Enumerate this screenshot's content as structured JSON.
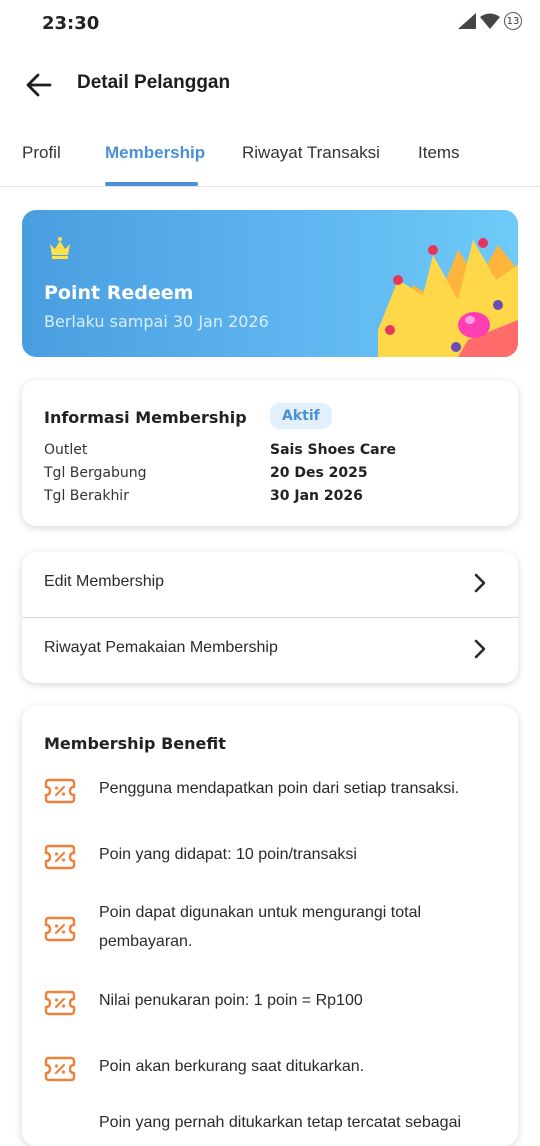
{
  "status_bar": {
    "time": "23:30",
    "notification_count": "13"
  },
  "header": {
    "title": "Detail Pelanggan"
  },
  "tabs": [
    {
      "label": "Profil"
    },
    {
      "label": "Membership"
    },
    {
      "label": "Riwayat Transaksi"
    },
    {
      "label": "Items"
    }
  ],
  "active_tab": "Membership",
  "hero": {
    "title": "Point Redeem",
    "subtitle": "Berlaku sampai 30 Jan 2026"
  },
  "membership_info": {
    "title": "Informasi Membership",
    "status": "Aktif",
    "rows": [
      {
        "label": "Outlet",
        "value": "Sais Shoes Care"
      },
      {
        "label": "Tgl Bergabung",
        "value": "20 Des 2025"
      },
      {
        "label": "Tgl Berakhir",
        "value": "30 Jan 2026"
      }
    ]
  },
  "menu": [
    {
      "label": "Edit Membership"
    },
    {
      "label": "Riwayat Pemakaian Membership"
    }
  ],
  "benefit": {
    "title": "Membership Benefit",
    "items": [
      "Pengguna mendapatkan poin dari setiap transaksi.",
      "Poin yang didapat: 10 poin/transaksi",
      "Poin dapat digunakan untuk mengurangi total pembayaran.",
      "Nilai penukaran poin: 1 poin = Rp100",
      "Poin akan berkurang saat ditukarkan.",
      "Poin yang pernah ditukarkan tetap tercatat sebagai"
    ]
  },
  "colors": {
    "accent": "#4a90d9",
    "benefit_icon": "#f0813a",
    "badge_bg": "#e1f0fb"
  }
}
